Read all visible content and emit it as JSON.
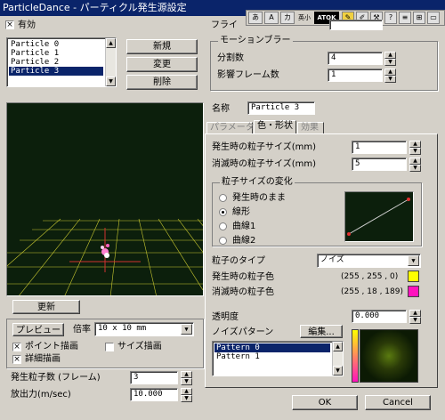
{
  "window": {
    "title": "ParticleDance - パーティクル発生源設定"
  },
  "ime_toolbar": {
    "jp_label": "英小",
    "atok_label": "ATOK"
  },
  "enable": {
    "label": "有効",
    "checked": true
  },
  "particles": {
    "items": [
      "Particle 0",
      "Particle 1",
      "Particle 2",
      "Particle 3"
    ],
    "selected_index": 3
  },
  "list_buttons": {
    "new": "新規",
    "change": "変更",
    "delete": "削除"
  },
  "frame_label": "フライ",
  "motion_blur": {
    "title": "モーションブラー",
    "divisions_label": "分割数",
    "divisions_value": "4",
    "frames_label": "影響フレーム数",
    "frames_value": "1"
  },
  "name": {
    "label": "名称",
    "value": "Particle 3"
  },
  "tabs": [
    {
      "label": "パラメータ"
    },
    {
      "label": "色・形状"
    },
    {
      "label": "効果"
    }
  ],
  "size": {
    "start_label": "発生時の粒子サイズ(mm)",
    "start_value": "1",
    "end_label": "消滅時の粒子サイズ(mm)",
    "end_value": "5"
  },
  "size_change": {
    "title": "粒子サイズの変化",
    "options": [
      "発生時のまま",
      "線形",
      "曲線1",
      "曲線2"
    ],
    "selected_index": 1
  },
  "particle_type": {
    "label": "粒子のタイプ",
    "value": "ノイズ"
  },
  "colors": {
    "start_label": "発生時の粒子色",
    "start_value": "(255 , 255 , 0)",
    "start_hex": "#ffff00",
    "end_label": "消滅時の粒子色",
    "end_value": "(255 , 18 , 189)",
    "end_hex": "#ff12bd"
  },
  "transparency": {
    "label": "透明度",
    "value": "0.000"
  },
  "noise_pattern": {
    "label": "ノイズパターン",
    "edit_label": "編集...",
    "items": [
      "Pattern 0",
      "Pattern 1"
    ],
    "selected_index": 0
  },
  "update_button": "更新",
  "preview": {
    "button": "プレビュー",
    "scale_label": "倍率",
    "scale_value": "10 x 10 mm",
    "point_draw": {
      "label": "ポイント描画",
      "checked": true
    },
    "size_draw": {
      "label": "サイズ描画",
      "checked": false
    },
    "detail_draw": {
      "label": "詳細描画",
      "checked": true
    }
  },
  "emission": {
    "count_label": "発生粒子数 (フレーム)",
    "count_value": "3",
    "power_label": "放出力(m/sec)",
    "power_value": "10.000"
  },
  "dialog": {
    "ok": "OK",
    "cancel": "Cancel"
  }
}
